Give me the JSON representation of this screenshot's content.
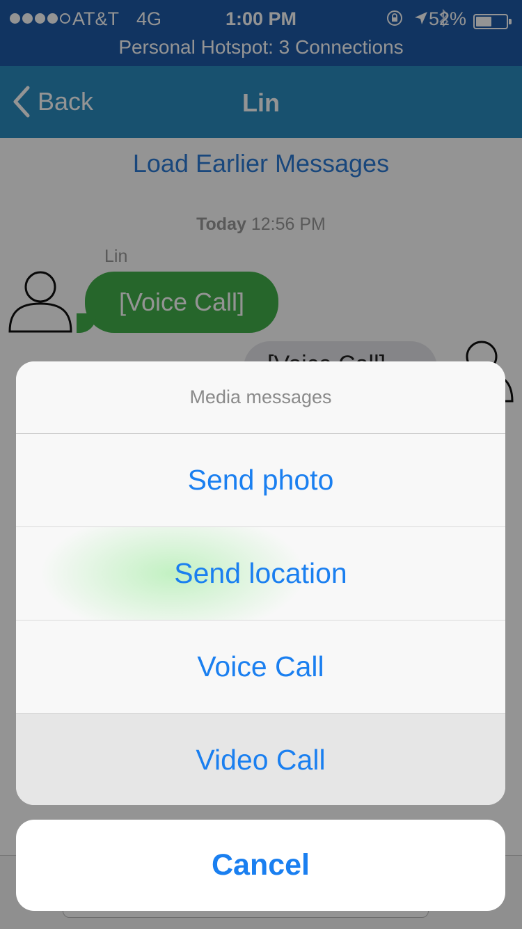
{
  "status_bar": {
    "carrier": "AT&T",
    "network": "4G",
    "time": "1:00 PM",
    "battery_percent": "52%",
    "battery_level": 0.52,
    "icons": [
      "rotation-lock-icon",
      "location-arrow-icon",
      "bluetooth-icon",
      "battery-icon"
    ]
  },
  "hotspot_banner": "Personal Hotspot: 3 Connections",
  "nav": {
    "back_label": "Back",
    "title": "Lin"
  },
  "chat": {
    "load_earlier": "Load Earlier Messages",
    "timestamp_day": "Today",
    "timestamp_time": "12:56 PM",
    "messages": [
      {
        "sender": "Lin",
        "text": "[Voice Call]",
        "direction": "incoming"
      },
      {
        "sender": "",
        "text": "[Voice Call]",
        "direction": "outgoing"
      }
    ]
  },
  "action_sheet": {
    "title": "Media messages",
    "options": [
      "Send photo",
      "Send location",
      "Voice Call",
      "Video Call"
    ],
    "cancel_label": "Cancel"
  },
  "colors": {
    "status_bar": "#1e5aa8",
    "nav_bar": "#2a8cc0",
    "incoming_bubble": "#42b04a",
    "action_text": "#1a7ff0"
  }
}
